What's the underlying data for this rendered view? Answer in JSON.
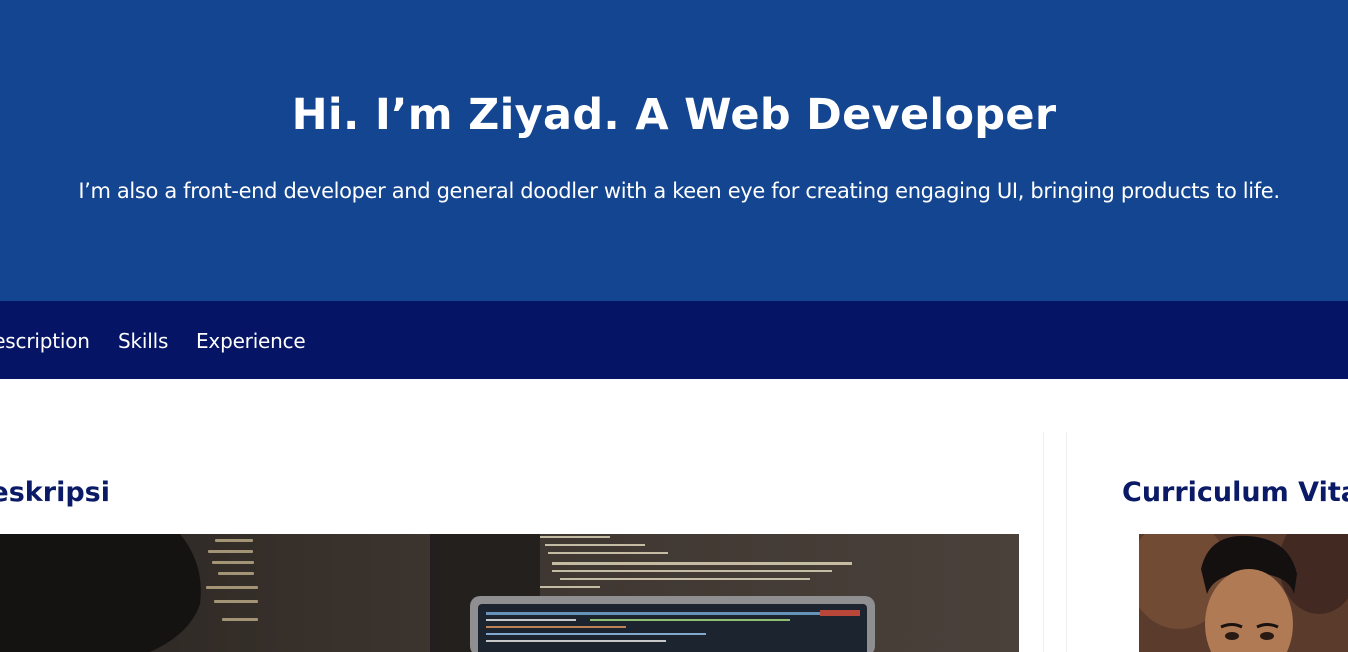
{
  "hero": {
    "title": "Hi. I’m Ziyad. A Web Developer",
    "subtitle": "I’m also a front-end developer and general doodler with a keen eye for creating engaging UI, bringing products to life."
  },
  "nav": {
    "items": [
      {
        "label": "Description"
      },
      {
        "label": "Skills"
      },
      {
        "label": "Experience"
      }
    ]
  },
  "main": {
    "title": "Deskripsi",
    "image_alt": "laptop with code on screen"
  },
  "sidebar": {
    "title": "Curriculum Vitae",
    "image_alt": "profile photo"
  },
  "colors": {
    "hero_bg": "#144591",
    "nav_bg": "#051465",
    "heading": "#0b1a66"
  }
}
